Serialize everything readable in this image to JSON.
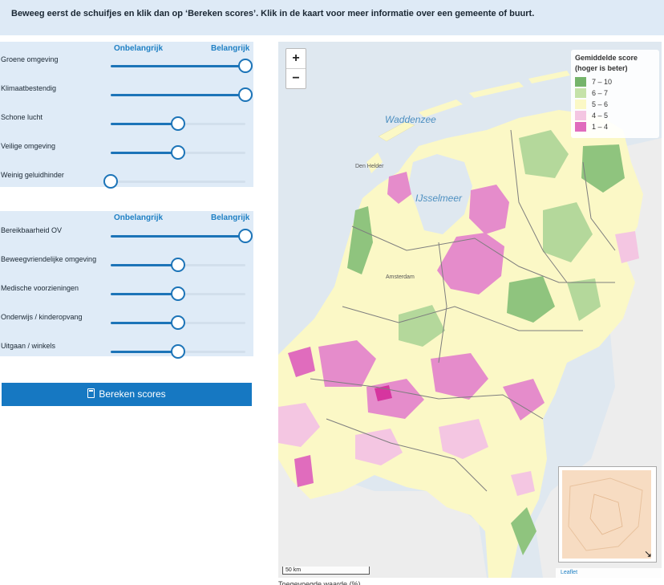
{
  "instruction": "Beweeg eerst de schuifjes en klik dan op ‘Bereken scores’. Klik in de kaart voor meer informatie over een gemeente of buurt.",
  "groups": [
    {
      "header_low": "Onbelangrijk",
      "header_high": "Belangrijk",
      "sliders": [
        {
          "label": "Groene omgeving",
          "value": 1.0
        },
        {
          "label": "Klimaatbestendig",
          "value": 1.0
        },
        {
          "label": "Schone lucht",
          "value": 0.5
        },
        {
          "label": "Veilige omgeving",
          "value": 0.5
        },
        {
          "label": "Weinig geluidhinder",
          "value": 0.0
        }
      ]
    },
    {
      "header_low": "Onbelangrijk",
      "header_high": "Belangrijk",
      "sliders": [
        {
          "label": "Bereikbaarheid OV",
          "value": 1.0
        },
        {
          "label": "Beweegvriendelijke omgeving",
          "value": 0.5
        },
        {
          "label": "Medische voorzieningen",
          "value": 0.5
        },
        {
          "label": "Onderwijs / kinderopvang",
          "value": 0.5
        },
        {
          "label": "Uitgaan / winkels",
          "value": 0.5
        }
      ]
    }
  ],
  "calc_button": {
    "label": "Bereken scores",
    "icon": "calculator-icon"
  },
  "map": {
    "zoom_in": "+",
    "zoom_out": "−",
    "legend": {
      "title": "Gemiddelde score",
      "subtitle": "(hoger is beter)",
      "items": [
        {
          "label": "7 – 10",
          "color": "#75b46b"
        },
        {
          "label": "6 – 7",
          "color": "#c5e2a9"
        },
        {
          "label": "5 – 6",
          "color": "#fbf8c6"
        },
        {
          "label": "4 – 5",
          "color": "#f4c6e2"
        },
        {
          "label": "1 – 4",
          "color": "#e06cbd"
        }
      ]
    },
    "labels": {
      "waddenzee": "Waddenzee",
      "ijsselmeer": "IJsselmeer",
      "den_helder": "Den Helder",
      "amsterdam": "Amsterdam"
    },
    "scale": "50 km",
    "attribution": "Leaflet",
    "below_text": "Toegevoegde waarde (%)"
  },
  "colors": {
    "accent": "#1c74b8",
    "panel": "#dfebf7",
    "banner": "#deeaf6"
  }
}
